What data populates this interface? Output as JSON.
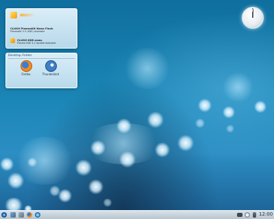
{
  "desktop": {
    "notification": {
      "items": [
        {
          "title": "CLUSH PlasmaKit News Flash",
          "subtitle": "PlasmaKit 5.5 (KDE) Available"
        },
        {
          "title": "CLUSH KDE.news",
          "subtitle": "Plasma KDE 4.2 Update Available"
        }
      ]
    },
    "folder_view": {
      "title": "Desktop Folder",
      "apps": [
        {
          "label": "Firefox",
          "icon": "firefox-icon"
        },
        {
          "label": "Thunderbird",
          "icon": "thunderbird-icon"
        }
      ]
    }
  },
  "taskbar": {
    "clock": "12:00",
    "icons": [
      "kde-menu-icon",
      "file-manager-icon",
      "system-icon",
      "firefox-icon",
      "network-icon",
      "display-icon",
      "volume-icon",
      "battery-icon"
    ]
  }
}
